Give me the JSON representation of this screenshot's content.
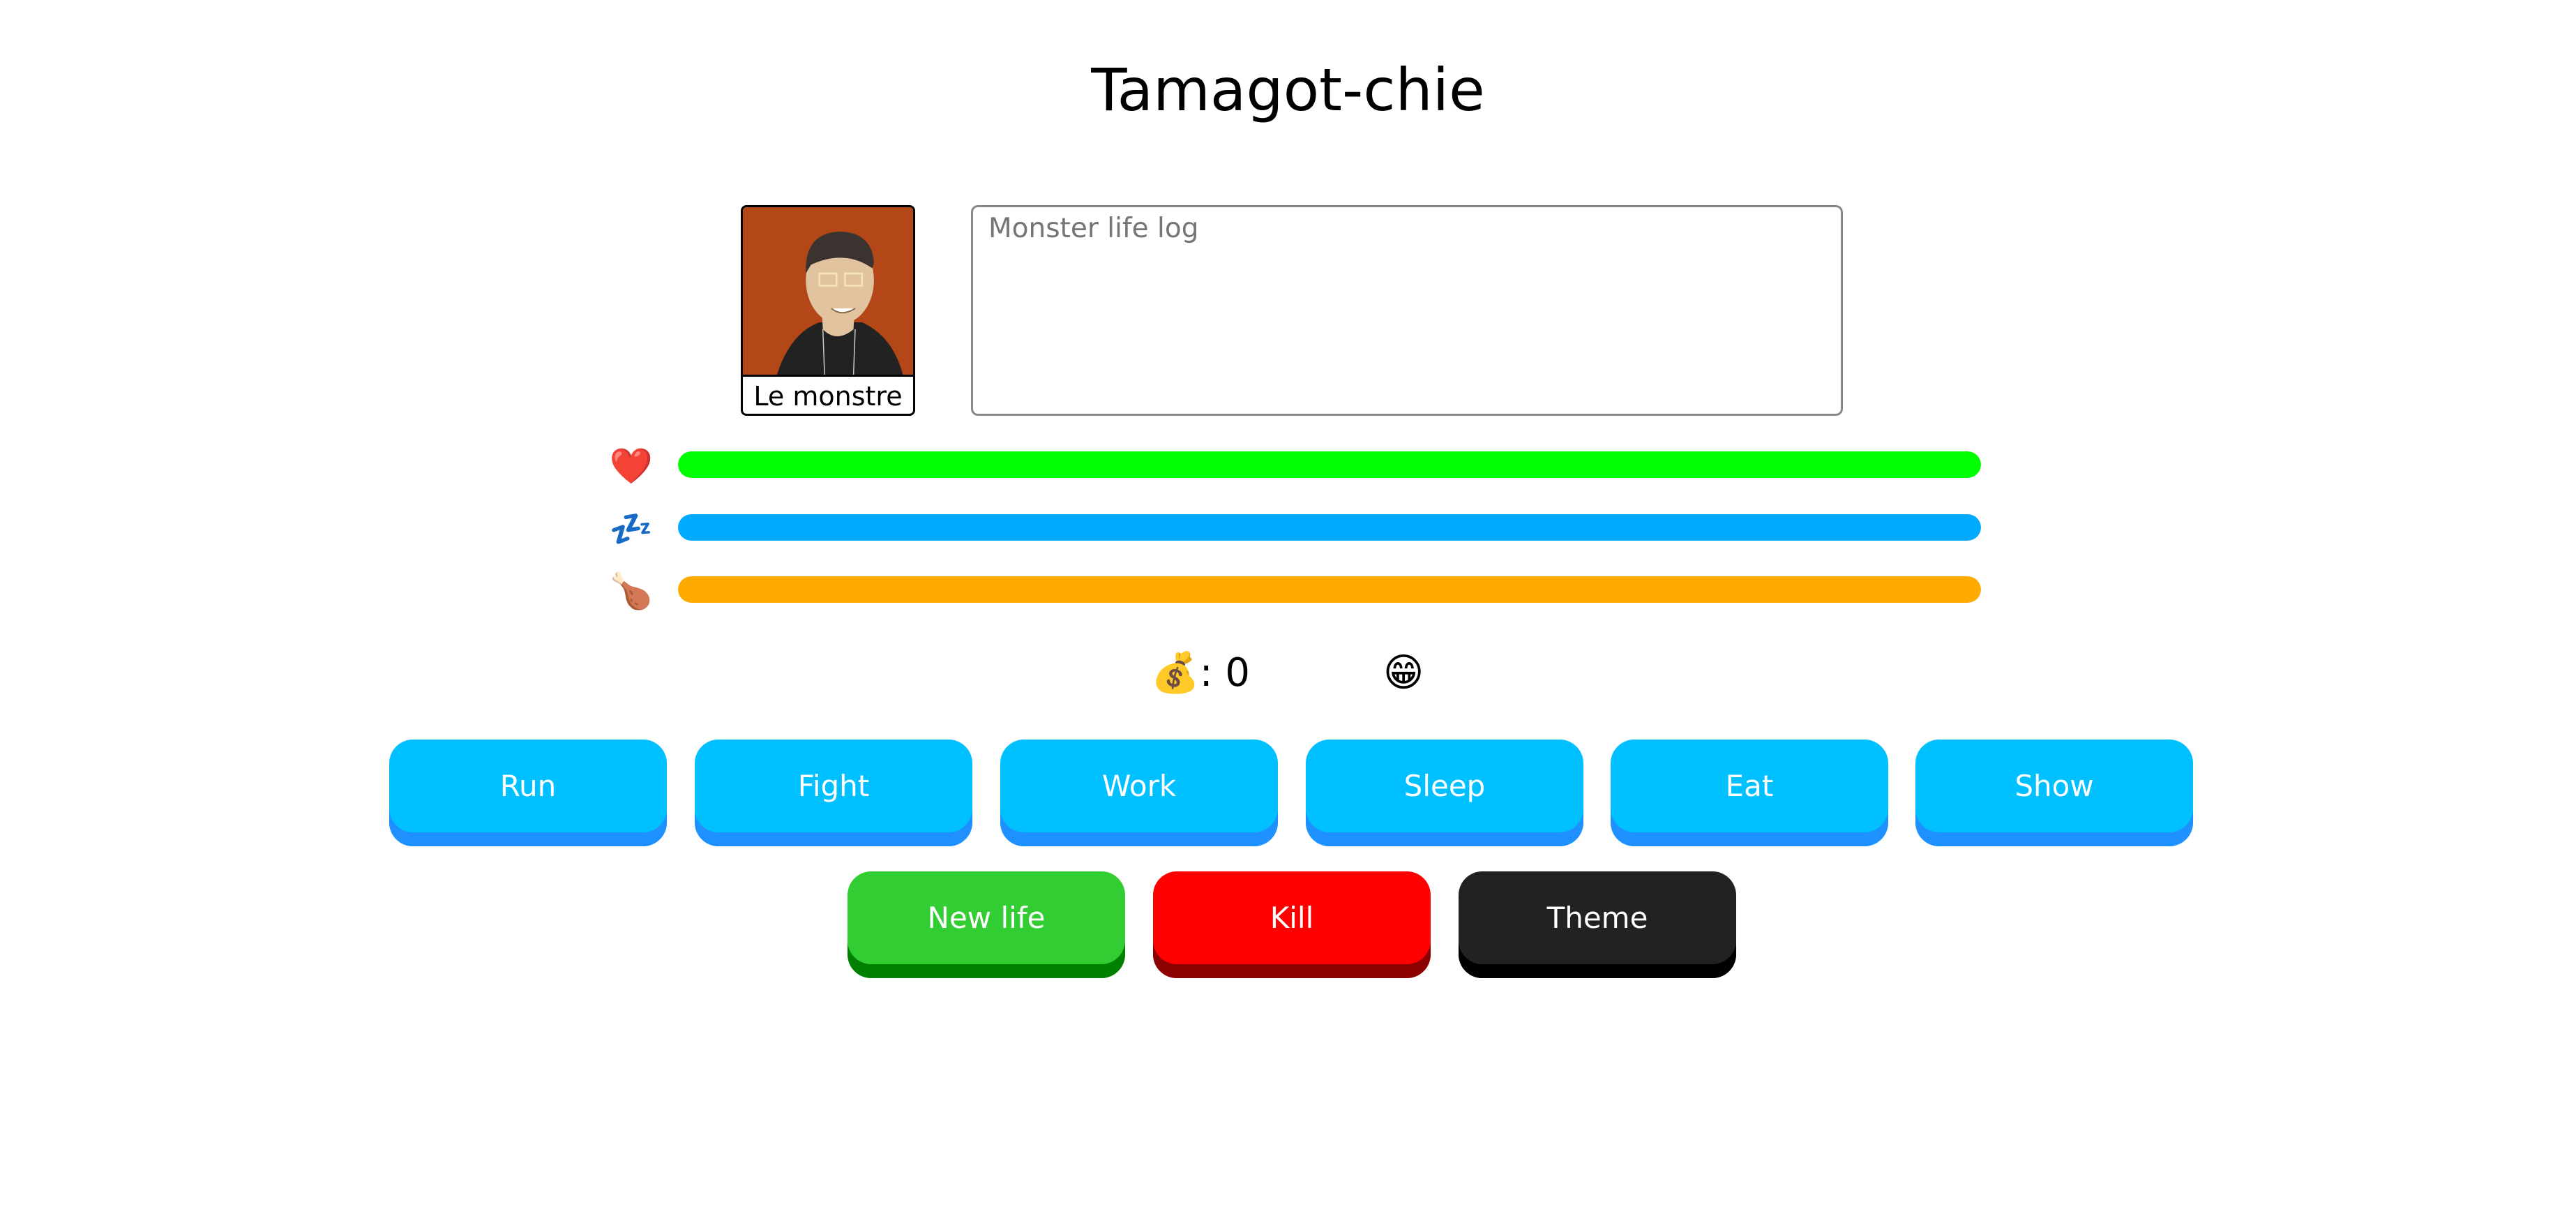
{
  "title": "Tamagot-chie",
  "monster": {
    "name": "Le monstre",
    "avatar": "cartoon-portrait"
  },
  "log": {
    "placeholder": "Monster life log"
  },
  "stats": [
    {
      "name": "health",
      "icon": "❤️",
      "icon_name": "heart-icon",
      "percent": 100,
      "color": "#00ff00"
    },
    {
      "name": "sleep",
      "icon": "💤",
      "icon_name": "zzz-icon",
      "percent": 100,
      "color": "#00aaff"
    },
    {
      "name": "food",
      "icon": "🍗",
      "icon_name": "drumstick-icon",
      "percent": 100,
      "color": "#ffaa00"
    }
  ],
  "money": {
    "icon": "💰",
    "label": ": 0"
  },
  "mood": {
    "icon": "😁"
  },
  "actions": [
    "Run",
    "Fight",
    "Work",
    "Sleep",
    "Eat",
    "Show"
  ],
  "controls": {
    "new_life": "New life",
    "kill": "Kill",
    "theme": "Theme"
  },
  "colors": {
    "action": "#00c0ff",
    "action_shadow": "#1e90ff",
    "new_life": "#32cd32",
    "new_life_shadow": "#008000",
    "kill": "#ff0000",
    "kill_shadow": "#8b0000",
    "theme": "#222222",
    "theme_shadow": "#000000"
  }
}
